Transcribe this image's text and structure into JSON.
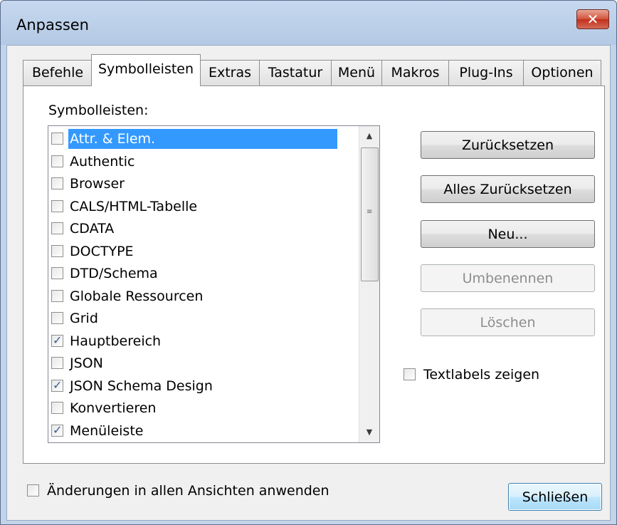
{
  "window": {
    "title": "Anpassen",
    "close_symbol": "✕"
  },
  "tabs": [
    {
      "label": "Befehle"
    },
    {
      "label": "Symbolleisten",
      "active": true
    },
    {
      "label": "Extras"
    },
    {
      "label": "Tastatur"
    },
    {
      "label": "Menü"
    },
    {
      "label": "Makros"
    },
    {
      "label": "Plug-Ins"
    },
    {
      "label": "Optionen"
    }
  ],
  "panel": {
    "label": "Symbolleisten:"
  },
  "toolbars": [
    {
      "label": "Attr. & Elem.",
      "checked": false,
      "selected": true
    },
    {
      "label": "Authentic",
      "checked": false
    },
    {
      "label": "Browser",
      "checked": false
    },
    {
      "label": "CALS/HTML-Tabelle",
      "checked": false
    },
    {
      "label": "CDATA",
      "checked": false
    },
    {
      "label": "DOCTYPE",
      "checked": false
    },
    {
      "label": "DTD/Schema",
      "checked": false
    },
    {
      "label": "Globale Ressourcen",
      "checked": false
    },
    {
      "label": "Grid",
      "checked": false
    },
    {
      "label": "Hauptbereich",
      "checked": true
    },
    {
      "label": "JSON",
      "checked": false
    },
    {
      "label": "JSON Schema Design",
      "checked": true
    },
    {
      "label": "Konvertieren",
      "checked": false
    },
    {
      "label": "Menüleiste",
      "checked": true
    }
  ],
  "buttons": {
    "reset": "Zurücksetzen",
    "reset_all": "Alles Zurücksetzen",
    "new": "Neu...",
    "rename": "Umbenennen",
    "delete": "Löschen",
    "close": "Schließen"
  },
  "options": {
    "show_text_labels": "Textlabels zeigen",
    "apply_all_views": "Änderungen in allen Ansichten anwenden"
  },
  "icons": {
    "scroll_up": "▲",
    "scroll_down": "▼",
    "check": "✓",
    "grip": "≡"
  },
  "colors": {
    "selection": "#3399ff",
    "title_gradient_top": "#c6d8ef",
    "close_red": "#c2301c",
    "default_button_blue": "#bee6fd"
  }
}
